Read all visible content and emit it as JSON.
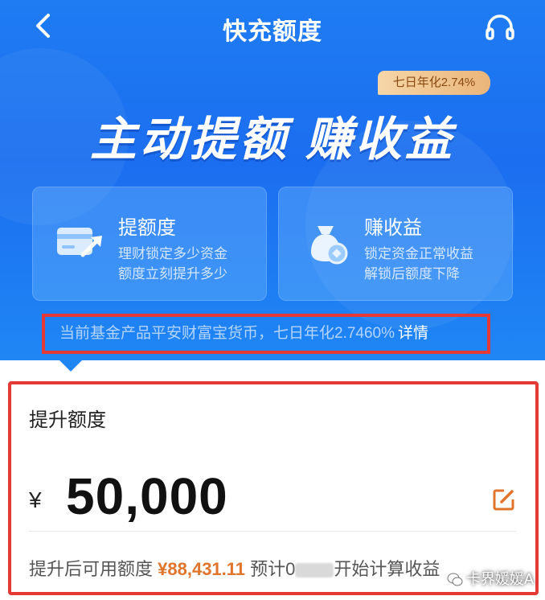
{
  "header": {
    "title": "快充额度",
    "back_icon": "chevron-left-icon",
    "support_icon": "headset-icon"
  },
  "hero": {
    "yield_badge": "七日年化2.74%",
    "slogan": "主动提额 赚收益",
    "background_color": "#1b6ef0"
  },
  "cards": [
    {
      "icon": "card-arrow-icon",
      "title": "提额度",
      "desc_line1": "理财锁定多少资金",
      "desc_line2": "额度立刻提升多少"
    },
    {
      "icon": "money-bag-icon",
      "title": "赚收益",
      "desc_line1": "锁定资金正常收益",
      "desc_line2": "解锁后额度下降"
    }
  ],
  "fund_info": {
    "text": "当前基金产品平安财富宝货币，七日年化2.7460%",
    "detail_link": "详情"
  },
  "boost": {
    "label": "提升额度",
    "currency": "¥",
    "amount": "50,000",
    "edit_icon": "edit-icon",
    "footer_prefix": "提升后可用额度",
    "available_amount": "¥88,431.11",
    "footer_mid": "预计0",
    "footer_suffix": "开始计算收益",
    "highlight_color": "#e0742a"
  },
  "watermark": {
    "text": "卡界媛媛A",
    "icon": "wechat-icon"
  },
  "annotation_color": "#e53935"
}
